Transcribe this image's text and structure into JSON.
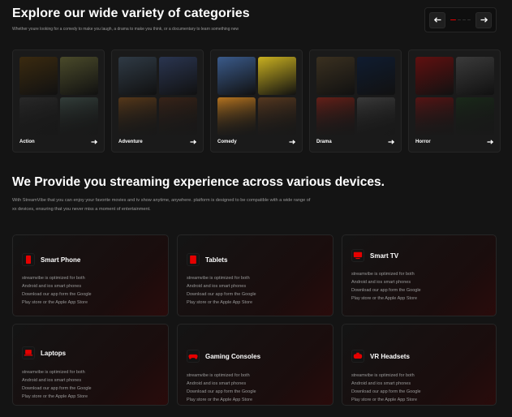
{
  "categories_section": {
    "title": "Explore our wide variety of categories",
    "subtitle": "Whether youre looking for a comedy to make you laugh, a drama to make you think, or a documentary to learn something new",
    "pager": {
      "prev": "previous-arrow-icon",
      "next": "next-arrow-icon",
      "dots": 4,
      "active_dot": 0
    },
    "cards": [
      {
        "label": "Action",
        "posters": [
          "#3a2a10",
          "#4a4a2a",
          "#2a2a2a",
          "#34403c"
        ]
      },
      {
        "label": "Adventure",
        "posters": [
          "#2f3a45",
          "#2a3550",
          "#5a3a1a",
          "#3a2418"
        ]
      },
      {
        "label": "Comedy",
        "posters": [
          "#3a5a8a",
          "#c9b020",
          "#c07a20",
          "#5a3a20"
        ]
      },
      {
        "label": "Drama",
        "posters": [
          "#3a3020",
          "#101c30",
          "#6a2018",
          "#3c3c3c"
        ]
      },
      {
        "label": "Horror",
        "posters": [
          "#601010",
          "#3a3a3a",
          "#5a1414",
          "#1a2a1a"
        ]
      }
    ]
  },
  "devices_section": {
    "title": "We Provide you streaming experience across various devices.",
    "description_line1": "With StreamVibe that you can enjoy your favorite movies and tv show anytime, anywhere. platform is designed to be compatible with a wide range of",
    "description_line2": "xx devices, ensuring that you never miss a moment of entertainment.",
    "accent_color": "#e50000",
    "devices": [
      {
        "title": "Smart Phone",
        "icon": "smartphone-icon",
        "desc": [
          "streamvibe is optimized for both",
          "Android and ios smart phones",
          "Download our app form the Google",
          "Play store or the Apple App Store"
        ]
      },
      {
        "title": "Tablets",
        "icon": "tablet-icon",
        "desc": [
          "streamvibe is optimized for both",
          "Android and ios smart phones",
          "Download our app form the Google",
          "Play store or the Apple App Store"
        ]
      },
      {
        "title": "Smart TV",
        "icon": "tv-icon",
        "desc": [
          "streamvibe is optimized for both",
          "Android and ios smart phones",
          "Download our app form the Google",
          "Play store or the Apple App Store"
        ]
      },
      {
        "title": "Laptops",
        "icon": "laptop-icon",
        "desc": [
          "streamvibe is optimized for both",
          "Android and ios smart phones",
          "Download our app form the Google",
          "Play store or the Apple App Store"
        ]
      },
      {
        "title": "Gaming Consoles",
        "icon": "gamepad-icon",
        "desc": [
          "streamvibe is optimized for both",
          "Android and ios smart phones",
          "Download our app form the Google",
          "Play store or the Apple App Store"
        ]
      },
      {
        "title": "VR Headsets",
        "icon": "vr-headset-icon",
        "desc": [
          "streamvibe is optimized for both",
          "Android and ios smart phones",
          "Download our app form the Google",
          "Play store or the Apple App Store"
        ]
      }
    ]
  }
}
